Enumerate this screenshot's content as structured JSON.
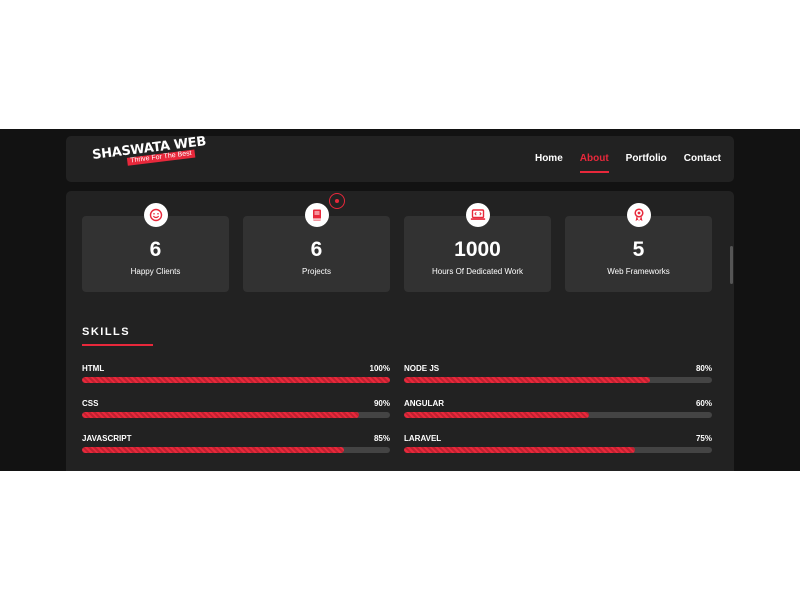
{
  "brand": {
    "name": "SHASWATA WEB",
    "tagline": "Thrive For The Best"
  },
  "nav": {
    "items": [
      {
        "label": "Home",
        "active": false
      },
      {
        "label": "About",
        "active": true
      },
      {
        "label": "Portfolio",
        "active": false
      },
      {
        "label": "Contact",
        "active": false
      }
    ]
  },
  "stats": [
    {
      "icon": "smiley-icon",
      "value": "6",
      "label": "Happy Clients"
    },
    {
      "icon": "book-icon",
      "value": "6",
      "label": "Projects"
    },
    {
      "icon": "laptop-code-icon",
      "value": "1000",
      "label": "Hours Of Dedicated Work"
    },
    {
      "icon": "award-icon",
      "value": "5",
      "label": "Web Frameworks"
    }
  ],
  "skills": {
    "title": "SKILLS",
    "items": [
      {
        "name": "HTML",
        "percent": 100,
        "percent_label": "100%"
      },
      {
        "name": "NODE JS",
        "percent": 80,
        "percent_label": "80%"
      },
      {
        "name": "CSS",
        "percent": 90,
        "percent_label": "90%"
      },
      {
        "name": "ANGULAR",
        "percent": 60,
        "percent_label": "60%"
      },
      {
        "name": "JAVASCRIPT",
        "percent": 85,
        "percent_label": "85%"
      },
      {
        "name": "LARAVEL",
        "percent": 75,
        "percent_label": "75%"
      }
    ]
  },
  "colors": {
    "accent": "#e8283b",
    "page_bg": "#121212",
    "panel_bg": "#222222",
    "card_bg": "#323232",
    "track_bg": "#444444",
    "text": "#ffffff"
  }
}
